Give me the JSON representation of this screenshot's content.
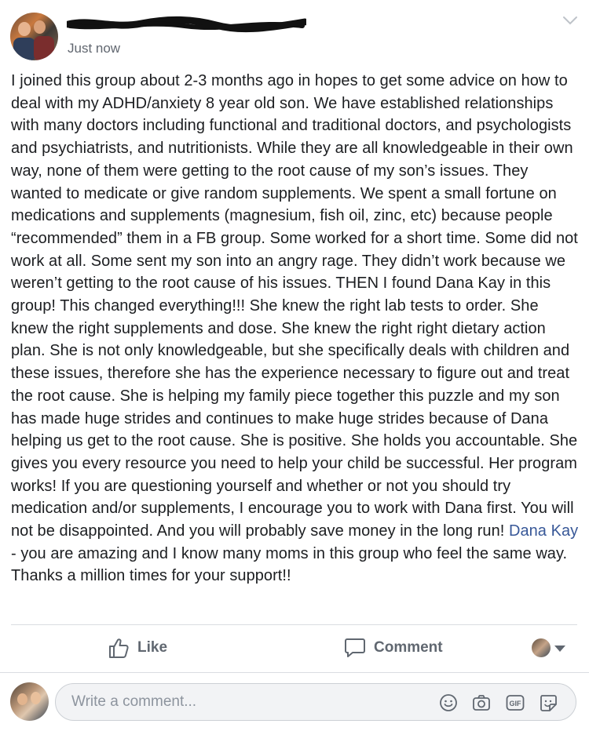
{
  "post": {
    "author": {
      "name_redacted": true
    },
    "timestamp": "Just now",
    "body": {
      "text_before_link": "I joined this group about 2-3 months ago in hopes to get some advice on how to deal with my ADHD/anxiety 8 year old son. We have established relationships with many doctors including functional and traditional doctors, and psychologists and psychiatrists, and nutritionists. While they are all knowledgeable in their own way, none of them were getting to the root cause of my son’s issues. They wanted to medicate or give random supplements. We spent a small fortune on medications and supplements (magnesium, fish oil, zinc, etc) because people “recommended” them in a FB group. Some worked for a short time. Some did not work at all. Some sent my son into an angry rage. They didn’t work because we weren’t getting to the root cause of his issues. THEN I found Dana Kay in this group! This changed everything!!! She knew the right lab tests to order. She knew the right supplements and dose. She knew the right right dietary action plan. She is not only knowledgeable, but she specifically deals with children and these issues, therefore she has the experience necessary to figure out and treat the root cause. She is helping my family piece together this puzzle and my son has made huge strides and continues to make huge strides because of Dana helping us get to the root cause. She is positive. She holds you accountable. She gives you every resource you need to help your child be successful. Her program works! If you are questioning yourself and whether or not you should try medication and/or supplements, I encourage you to work with Dana first. You will not be disappointed. And you will probably save money in the long run! ",
      "mention": "Dana Kay",
      "text_after_link": " - you are amazing and I know many moms in this group who feel the same way. Thanks a million times for your support!!"
    }
  },
  "actions": {
    "like_label": "Like",
    "comment_label": "Comment"
  },
  "comment_composer": {
    "placeholder": "Write a comment...",
    "icons": [
      "emoji-icon",
      "camera-icon",
      "gif-icon",
      "sticker-icon"
    ]
  },
  "colors": {
    "text": "#1c1e21",
    "secondary_text": "#616770",
    "link": "#385898",
    "divider": "#dadde1",
    "input_bg": "#f2f3f5"
  }
}
